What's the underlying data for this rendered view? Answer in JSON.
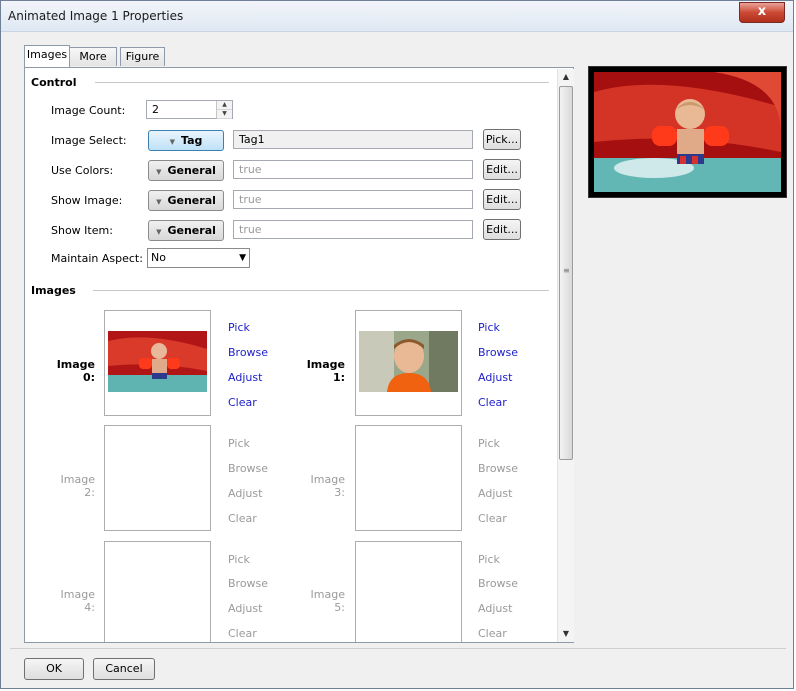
{
  "window": {
    "title": "Animated Image 1 Properties",
    "close_glyph": "x"
  },
  "tabs": [
    {
      "label": "Images",
      "active": true
    },
    {
      "label": "More",
      "active": false
    },
    {
      "label": "Figure",
      "active": false
    }
  ],
  "control": {
    "header": "Control",
    "image_count": {
      "label": "Image Count:",
      "value": "2"
    },
    "image_select": {
      "label": "Image Select:",
      "mode": "Tag",
      "value": "Tag1",
      "button": "Pick..."
    },
    "use_colors": {
      "label": "Use Colors:",
      "mode": "General",
      "placeholder": "true",
      "button": "Edit..."
    },
    "show_image": {
      "label": "Show Image:",
      "mode": "General",
      "placeholder": "true",
      "button": "Edit..."
    },
    "show_item": {
      "label": "Show Item:",
      "mode": "General",
      "placeholder": "true",
      "button": "Edit..."
    },
    "maintain_aspect": {
      "label": "Maintain Aspect:",
      "selected": "No"
    }
  },
  "images": {
    "header": "Images",
    "slots": [
      {
        "label": "Image 0:",
        "enabled": true,
        "has_image": true
      },
      {
        "label": "Image 1:",
        "enabled": true,
        "has_image": true
      },
      {
        "label": "Image 2:",
        "enabled": false,
        "has_image": false
      },
      {
        "label": "Image 3:",
        "enabled": false,
        "has_image": false
      },
      {
        "label": "Image 4:",
        "enabled": false,
        "has_image": false
      },
      {
        "label": "Image 5:",
        "enabled": false,
        "has_image": false
      }
    ],
    "actions": [
      "Pick",
      "Browse",
      "Adjust",
      "Clear"
    ]
  },
  "footer": {
    "ok": "OK",
    "cancel": "Cancel"
  },
  "colors": {
    "link": "#1d1dc9",
    "disabled": "#9a9a9a",
    "accent_focus": "#3c7fb1",
    "close": "#cc4a35"
  }
}
